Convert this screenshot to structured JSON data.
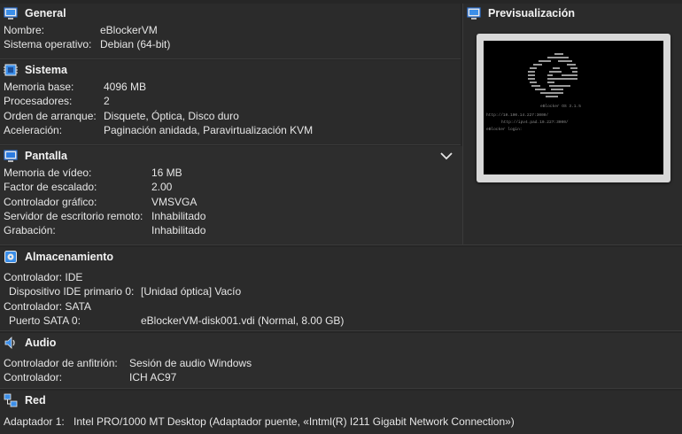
{
  "general": {
    "title": "General",
    "rows": [
      {
        "key": "Nombre:",
        "value": "eBlockerVM"
      },
      {
        "key": "Sistema operativo:",
        "value": "Debian (64-bit)"
      }
    ]
  },
  "sistema": {
    "title": "Sistema",
    "rows": [
      {
        "key": "Memoria base:",
        "value": "4096 MB"
      },
      {
        "key": "Procesadores:",
        "value": "2"
      },
      {
        "key": "Orden de arranque:",
        "value": "Disquete, Óptica, Disco duro"
      },
      {
        "key": "Aceleración:",
        "value": "Paginación anidada, Paravirtualización KVM"
      }
    ]
  },
  "preview": {
    "title": "Previsualización",
    "screen_lines": [
      "eBlocker OS 3.1.5",
      "http://10.100.14.227:3000/",
      "http://ipv4.pad.10.227:3000/",
      "eBlocker login:"
    ]
  },
  "pantalla": {
    "title": "Pantalla",
    "rows": [
      {
        "key": "Memoria de vídeo:",
        "value": "16 MB"
      },
      {
        "key": "Factor de escalado:",
        "value": "2.00"
      },
      {
        "key": "Controlador gráfico:",
        "value": "VMSVGA"
      },
      {
        "key": "Servidor de escritorio remoto:",
        "value": "Inhabilitado"
      },
      {
        "key": "Grabación:",
        "value": "Inhabilitado"
      }
    ]
  },
  "almacenamiento": {
    "title": "Almacenamiento",
    "rows": [
      {
        "key": "Controlador: IDE",
        "value": ""
      },
      {
        "key": "  Dispositivo IDE primario 0:",
        "value": "[Unidad óptica] Vacío"
      },
      {
        "key": "Controlador: SATA",
        "value": ""
      },
      {
        "key": "  Puerto SATA 0:",
        "value": "eBlockerVM-disk001.vdi (Normal, 8.00 GB)"
      }
    ]
  },
  "audio": {
    "title": "Audio",
    "rows": [
      {
        "key": "Controlador de anfitrión:",
        "value": "Sesión de audio Windows"
      },
      {
        "key": "Controlador:",
        "value": "ICH AC97"
      }
    ]
  },
  "red": {
    "title": "Red",
    "rows": [
      {
        "key": "Adaptador 1:",
        "value": "Intel PRO/1000 MT Desktop (Adaptador puente, «Intml(R) I211 Gigabit Network Connection»)"
      }
    ]
  },
  "colors": {
    "background": "#262626",
    "panel": "#2b2b2b",
    "text": "#e6e6e6",
    "icon_blue": "#3b8ee8"
  }
}
